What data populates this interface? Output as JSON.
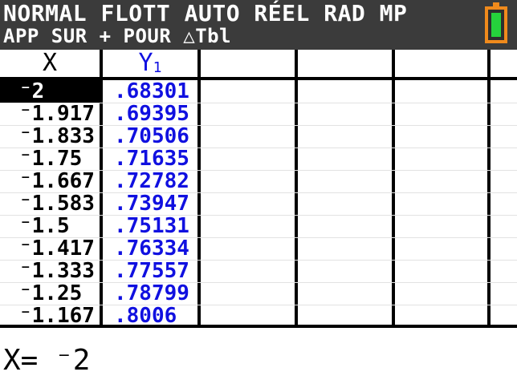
{
  "status_bar": {
    "line1": "NORMAL FLOTT AUTO RÉEL RAD MP",
    "line2": "APP SUR + POUR △Tbl",
    "battery_icon": "battery-full-icon",
    "battery_color": "#f08a1c",
    "battery_fill_color": "#25d23c"
  },
  "table": {
    "headers": {
      "x": "X",
      "y": "Y",
      "y_sub": "1"
    },
    "x_color": "#000000",
    "y_color": "#1010e0",
    "selected_row": 0,
    "rows": [
      {
        "x": "⁻2",
        "y": ".68301"
      },
      {
        "x": "⁻1.917",
        "y": ".69395"
      },
      {
        "x": "⁻1.833",
        "y": ".70506"
      },
      {
        "x": "⁻1.75",
        "y": ".71635"
      },
      {
        "x": "⁻1.667",
        "y": ".72782"
      },
      {
        "x": "⁻1.583",
        "y": ".73947"
      },
      {
        "x": "⁻1.5",
        "y": ".75131"
      },
      {
        "x": "⁻1.417",
        "y": ".76334"
      },
      {
        "x": "⁻1.333",
        "y": ".77557"
      },
      {
        "x": "⁻1.25",
        "y": ".78799"
      },
      {
        "x": "⁻1.167",
        "y": ".8006"
      }
    ]
  },
  "entry_line": "X= ⁻2"
}
